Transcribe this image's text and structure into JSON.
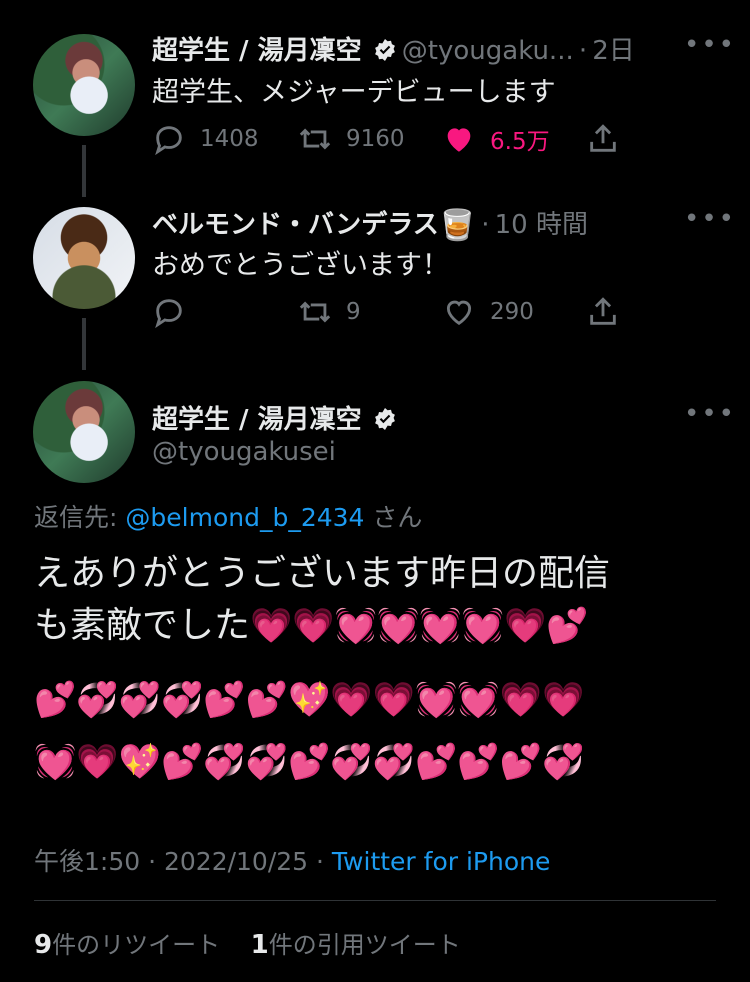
{
  "tweets": [
    {
      "name": "超学生 / 湯月凜空",
      "handle": "@tyougaku...",
      "sep": "·",
      "time": "2日",
      "text": "超学生、メジャーデビューします",
      "replies": "1408",
      "retweets": "9160",
      "likes": "6.5万",
      "liked": true
    },
    {
      "name": "ベルモンド・バンデラス",
      "name_emoji": "🥃",
      "sep": "·",
      "time": "10 時間",
      "text": "おめでとうございます！",
      "replies": "",
      "retweets": "9",
      "likes": "290",
      "liked": false
    }
  ],
  "main_tweet": {
    "name": "超学生 / 湯月凜空",
    "handle": "@tyougakusei",
    "reply_prefix": "返信先:",
    "reply_to": "@belmond_b_2434",
    "reply_suffix": "さん",
    "text_line1": "えありがとうございます昨日の配信",
    "text_line2_prefix": "も素敵でした",
    "emoji_line1": "💗💗💓💓💓💓💗💕",
    "emoji_line2": "💕💞💞💞💕💕💖💗💗💓💓💗💗",
    "emoji_line3": "💓💗💖💕💞💞💕💞💞💕💕💕💞",
    "timestamp": "午後1:50 · 2022/10/25 · ",
    "source": "Twitter for iPhone",
    "retweet_count": "9",
    "retweet_label": "件のリツイート",
    "quote_count": "1",
    "quote_label": "件の引用ツイート"
  },
  "colors": {
    "background": "#000000",
    "text": "#e7e9ea",
    "muted": "#71767b",
    "link": "#1d9bf0",
    "like": "#f91880"
  },
  "icons": [
    "verified-icon",
    "reply-icon",
    "retweet-icon",
    "like-icon",
    "share-icon",
    "more-icon"
  ]
}
